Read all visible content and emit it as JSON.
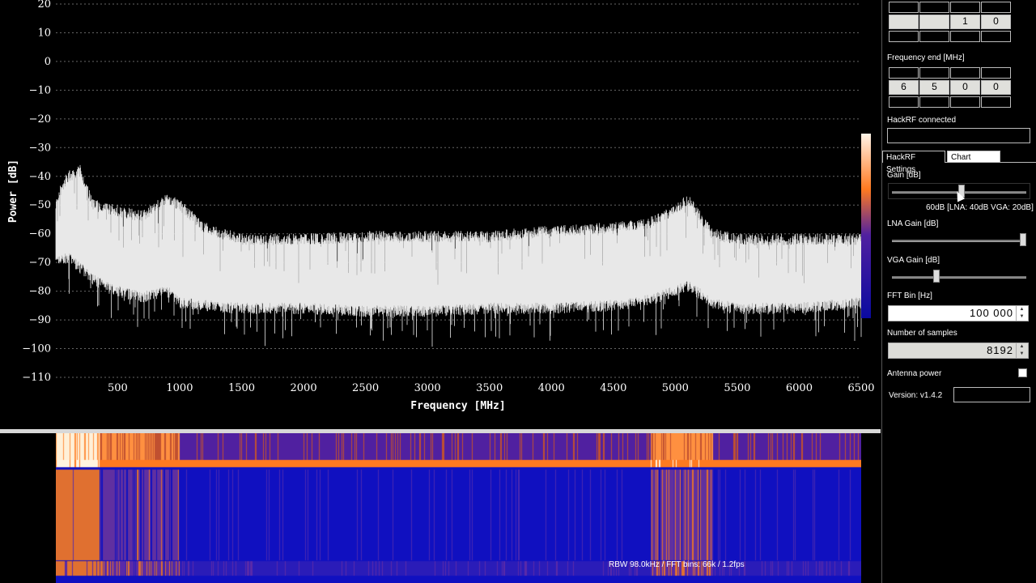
{
  "chart_data": {
    "type": "line",
    "title": "",
    "xlabel": "Frequency [MHz]",
    "ylabel": "Power [dB]",
    "xlim": [
      1,
      6500
    ],
    "ylim": [
      -110,
      20
    ],
    "x_ticks": [
      500,
      1000,
      1500,
      2000,
      2500,
      3000,
      3500,
      4000,
      4500,
      5000,
      5500,
      6000,
      6500
    ],
    "y_ticks": [
      20,
      10,
      0,
      -10,
      -20,
      -30,
      -40,
      -50,
      -60,
      -70,
      -80,
      -90,
      -100,
      -110
    ],
    "grid": true,
    "series": [
      {
        "x": [
          1,
          100,
          200,
          300,
          500,
          700,
          900,
          1000,
          1200,
          1500,
          2000,
          2500,
          3000,
          3500,
          4000,
          4500,
          4800,
          5000,
          5100,
          5300,
          5500,
          6000,
          6500
        ],
        "upper": [
          -48,
          -40,
          -38,
          -50,
          -52,
          -54,
          -48,
          -50,
          -58,
          -62,
          -62,
          -61,
          -61,
          -61,
          -59,
          -58,
          -56,
          -52,
          -48,
          -60,
          -62,
          -62,
          -62
        ],
        "lower": [
          -70,
          -68,
          -72,
          -76,
          -80,
          -82,
          -80,
          -84,
          -85,
          -86,
          -86,
          -87,
          -87,
          -86,
          -86,
          -85,
          -83,
          -80,
          -78,
          -84,
          -86,
          -86,
          -84
        ]
      }
    ],
    "colors": {
      "trace": "#e8e8e8",
      "grid": "#666666",
      "background": "#000000"
    }
  },
  "waterfall": {
    "status": "RBW 98.0kHz / FFT bins: 66k / 1.2fps",
    "colors": [
      "#1010b0",
      "#4020a0",
      "#c05030",
      "#ff8c30",
      "#fff0d0"
    ]
  },
  "panel": {
    "freq_start_digits": [
      "",
      "",
      "1",
      "0"
    ],
    "freq_end_label": "Frequency end [MHz]",
    "freq_end_digits": [
      "6",
      "5",
      "0",
      "0"
    ],
    "hackrf_connected_label": "HackRF connected",
    "tabs": {
      "settings": "HackRF Settings",
      "chart": "Chart options"
    },
    "gain_label": "Gain [dB]",
    "gain_value": 60,
    "gain_readout": "60dB  [LNA: 40dB  VGA: 20dB]",
    "lna_label": "LNA Gain [dB]",
    "lna_value": 40,
    "vga_label": "VGA Gain [dB]",
    "vga_value": 20,
    "fft_label": "FFT Bin [Hz]",
    "fft_value": "100 000",
    "samples_label": "Number of samples",
    "samples_value": "8192",
    "antenna_label": "Antenna power",
    "version_label": "Version: v1.4.2"
  }
}
